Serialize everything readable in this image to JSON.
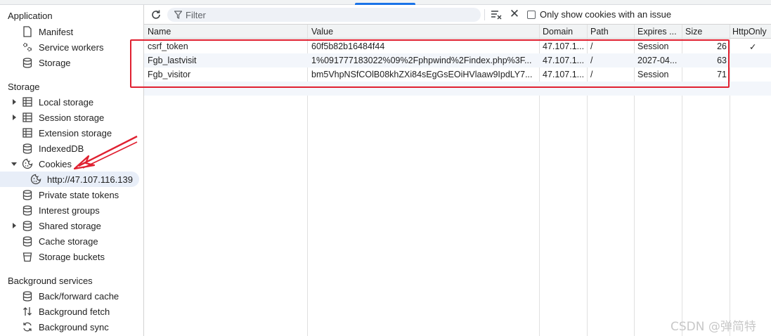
{
  "sidebar": {
    "application": {
      "title": "Application",
      "items": [
        {
          "label": "Manifest",
          "icon": "document-icon"
        },
        {
          "label": "Service workers",
          "icon": "gears-icon"
        },
        {
          "label": "Storage",
          "icon": "database-icon"
        }
      ]
    },
    "storage": {
      "title": "Storage",
      "items": [
        {
          "label": "Local storage",
          "icon": "table-icon"
        },
        {
          "label": "Session storage",
          "icon": "table-icon"
        },
        {
          "label": "Extension storage",
          "icon": "table-icon"
        },
        {
          "label": "IndexedDB",
          "icon": "database-icon"
        },
        {
          "label": "Cookies",
          "icon": "cookie-icon"
        },
        {
          "label": "http://47.107.116.139",
          "icon": "cookie-icon"
        },
        {
          "label": "Private state tokens",
          "icon": "database-icon"
        },
        {
          "label": "Interest groups",
          "icon": "database-icon"
        },
        {
          "label": "Shared storage",
          "icon": "database-icon"
        },
        {
          "label": "Cache storage",
          "icon": "database-icon"
        },
        {
          "label": "Storage buckets",
          "icon": "bucket-icon"
        }
      ]
    },
    "background": {
      "title": "Background services",
      "items": [
        {
          "label": "Back/forward cache",
          "icon": "database-icon"
        },
        {
          "label": "Background fetch",
          "icon": "arrows-updown-icon"
        },
        {
          "label": "Background sync",
          "icon": "sync-icon"
        }
      ]
    }
  },
  "toolbar": {
    "filter_placeholder": "Filter",
    "only_issue_label": "Only show cookies with an issue",
    "only_issue_checked": false
  },
  "table": {
    "columns": [
      "Name",
      "Value",
      "Domain",
      "Path",
      "Expires ...",
      "Size",
      "HttpOnly"
    ],
    "rows": [
      {
        "name": "csrf_token",
        "value": "60f5b82b16484f44",
        "domain": "47.107.1...",
        "path": "/",
        "expires": "Session",
        "size": "26",
        "httponly": "✓"
      },
      {
        "name": "Fgb_lastvisit",
        "value": "1%091777183022%09%2Fphpwind%2Findex.php%3F...",
        "domain": "47.107.1...",
        "path": "/",
        "expires": "2027-04...",
        "size": "63",
        "httponly": ""
      },
      {
        "name": "Fgb_visitor",
        "value": "bm5VhpNSfCOlB08khZXi84sEgGsEOiHVlaaw9IpdLY7...",
        "domain": "47.107.1...",
        "path": "/",
        "expires": "Session",
        "size": "71",
        "httponly": ""
      }
    ]
  },
  "annotation": {
    "box_color": "#e02030"
  },
  "watermark": "CSDN @弹简特"
}
